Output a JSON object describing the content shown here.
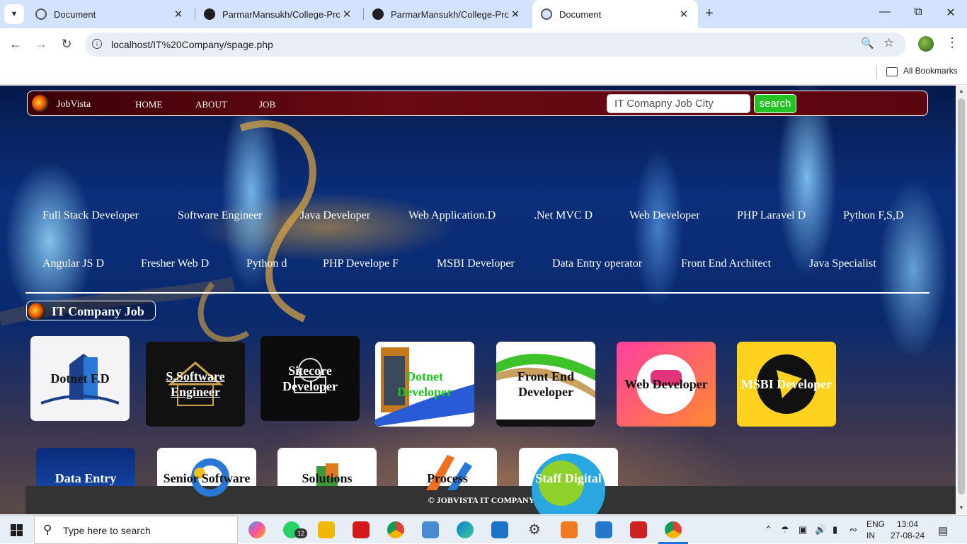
{
  "browser": {
    "tabs": [
      {
        "title": "Document",
        "icon": "globe-icon",
        "active": false
      },
      {
        "title": "ParmarMansukh/College-Project",
        "icon": "github-icon",
        "active": false
      },
      {
        "title": "ParmarMansukh/College-Project",
        "icon": "github-icon",
        "active": false
      },
      {
        "title": "Document",
        "icon": "globe-icon",
        "active": true
      }
    ],
    "new_tab": "+",
    "url": "localhost/IT%20Company/spage.php",
    "bookmarks_label": "All Bookmarks"
  },
  "site": {
    "brand": "JobVista",
    "nav": [
      "HOME",
      "ABOUT",
      "JOB"
    ],
    "search_placeholder": "IT Comapny Job City",
    "search_button": "search",
    "categories_row1": [
      "Full Stack Developer",
      "Software Engineer",
      "Java Developer",
      "Web Application.D",
      ".Net MVC D",
      "Web Developer",
      "PHP Laravel D",
      "Python F,S,D"
    ],
    "categories_row2": [
      "Angular JS D",
      "Fresher Web D",
      "Python d",
      "PHP Develope F",
      "MSBI Developer",
      "Data Entry operator",
      "Front End Architect",
      "Java Specialist"
    ],
    "section_title": "IT Company Job",
    "cards_row1": [
      {
        "line1": "Dotnet F.D",
        "line2": ""
      },
      {
        "line1": "S.Software",
        "line2": "Engineer"
      },
      {
        "line1": "Sitecore",
        "line2": "Developer"
      },
      {
        "line1": "Dotnet",
        "line2": "Developer"
      },
      {
        "line1": "Front End",
        "line2": "Developer"
      },
      {
        "line1": "Web Developer",
        "line2": ""
      },
      {
        "line1": "MSBI Developer",
        "line2": ""
      }
    ],
    "cards_row2": [
      {
        "line1": "Data Entry"
      },
      {
        "line1": "Senior Software"
      },
      {
        "line1": "Solutions"
      },
      {
        "line1": "Process"
      },
      {
        "line1": "Staff Digital"
      }
    ],
    "footer": "© JOBVISTA IT COMPANY JOB",
    "accent_color": "#22c322",
    "navbar_color": "#6a0a12"
  },
  "taskbar": {
    "search_placeholder": "Type here to search",
    "whatsapp_badge": "12",
    "language": "ENG",
    "region": "IN",
    "time": "13:04",
    "date": "27-08-24"
  }
}
